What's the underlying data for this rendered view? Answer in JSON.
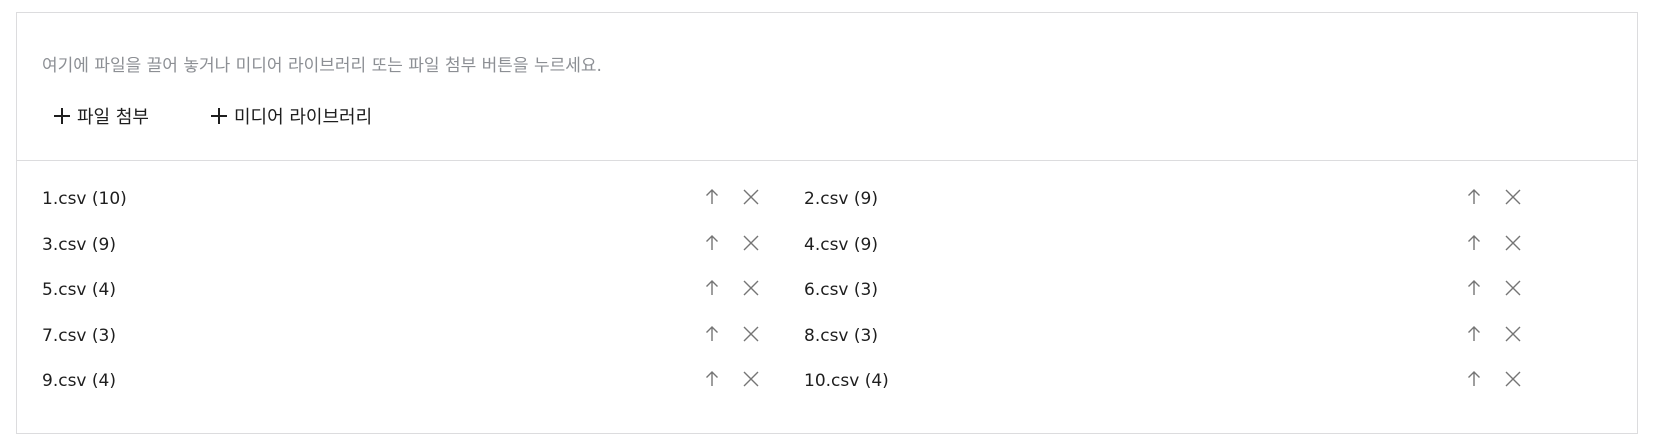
{
  "upload": {
    "hint": "여기에 파일을 끌어 놓거나 미디어 라이브러리 또는 파일 첨부 버튼을 누르세요.",
    "attach_label": "파일 첨부",
    "media_label": "미디어 라이브러리"
  },
  "files": [
    {
      "name": "1.csv (10)"
    },
    {
      "name": "2.csv (9)"
    },
    {
      "name": "3.csv (9)"
    },
    {
      "name": "4.csv (9)"
    },
    {
      "name": "5.csv (4)"
    },
    {
      "name": "6.csv (3)"
    },
    {
      "name": "7.csv (3)"
    },
    {
      "name": "8.csv (3)"
    },
    {
      "name": "9.csv (4)"
    },
    {
      "name": "10.csv (4)"
    }
  ],
  "icons": {
    "add": "plus-icon",
    "move_up": "arrow-up-icon",
    "remove": "close-icon"
  },
  "colors": {
    "text": "#1e1e1e",
    "hint": "#8c8f94",
    "icon": "#757575",
    "border": "#dcdcde"
  }
}
